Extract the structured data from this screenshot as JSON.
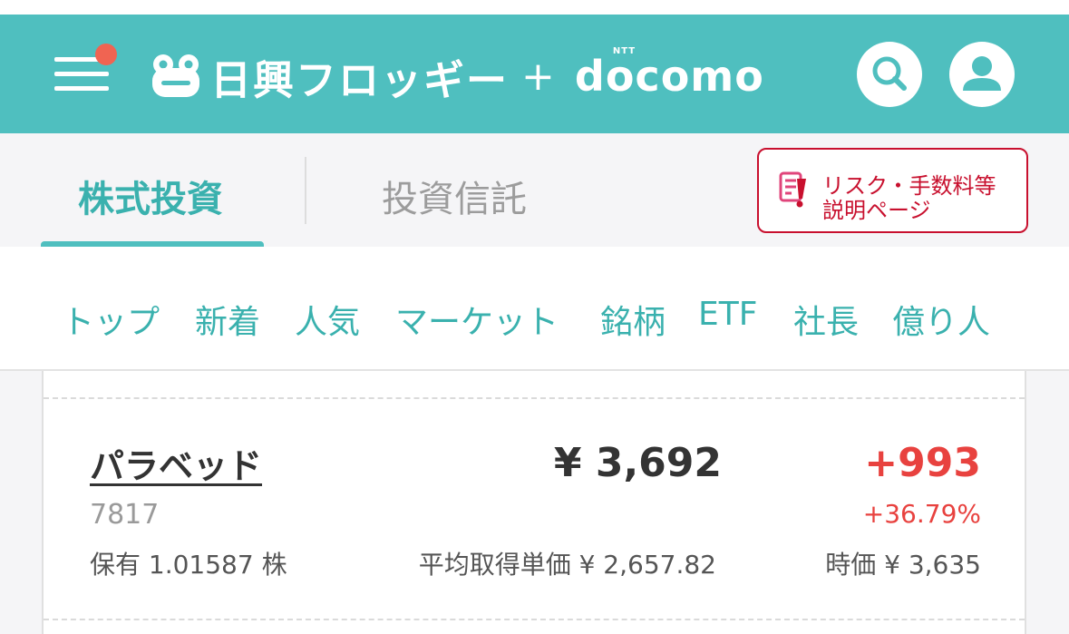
{
  "header": {
    "brand_name": "日興フロッギー",
    "brand_plus": "+",
    "partner_name": "docomo",
    "partner_superscript": "NTT",
    "bg_color": "#4fbfbf",
    "notification_dot_color": "#f06452"
  },
  "tabs": {
    "items": [
      {
        "label": "株式投資",
        "active": true
      },
      {
        "label": "投資信託",
        "active": false
      }
    ],
    "risk_button": {
      "line1": "リスク・手数料等",
      "line2": "説明ページ",
      "color": "#c8102e"
    }
  },
  "subnav": {
    "items": [
      "トップ",
      "新着",
      "人気",
      "マーケット",
      "銘柄",
      "ETF",
      "社長",
      "億り人"
    ]
  },
  "holding_card": {
    "name": "パラベッド",
    "code": "7817",
    "price": "¥ 3,692",
    "change": "+993",
    "change_pct": "+36.79%",
    "holding": "保有 1.01587 株",
    "avg_cost": "平均取得単価 ¥ 2,657.82",
    "market_price": "時価 ¥ 3,635",
    "change_color": "#e8423f"
  }
}
